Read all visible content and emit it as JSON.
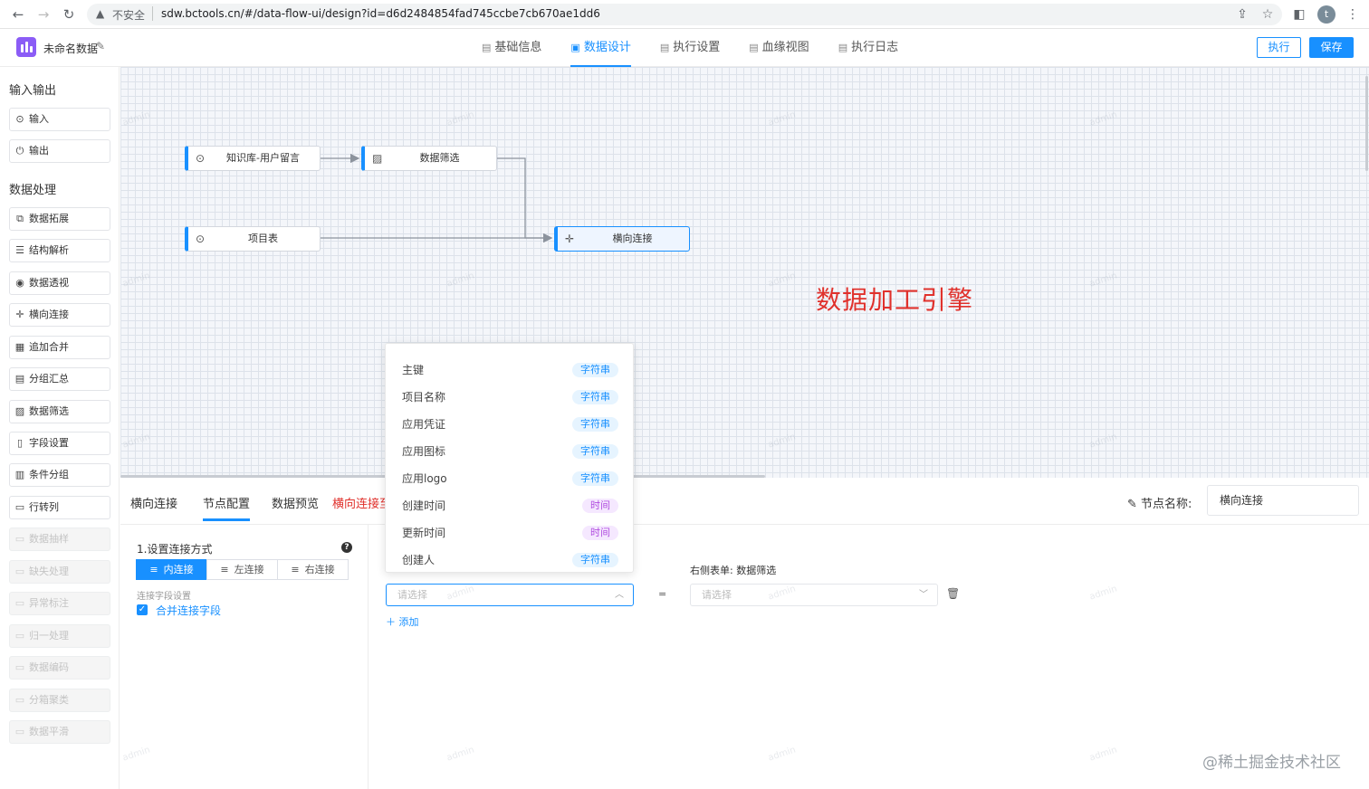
{
  "browser": {
    "insecure_label": "不安全",
    "url": "sdw.bctools.cn/#/data-flow-ui/design?id=d6d2484854fad745ccbe7cb670ae1dd6",
    "profile_initial": "t"
  },
  "header": {
    "app_title": "未命名数据",
    "tabs": [
      {
        "label": "基础信息",
        "icon": "document-icon"
      },
      {
        "label": "数据设计",
        "icon": "design-icon",
        "active": true
      },
      {
        "label": "执行设置",
        "icon": "document-icon"
      },
      {
        "label": "血缘视图",
        "icon": "document-icon"
      },
      {
        "label": "执行日志",
        "icon": "document-icon"
      }
    ],
    "run_label": "执行",
    "save_label": "保存"
  },
  "sidebar": {
    "io_title": "输入输出",
    "io_items": [
      {
        "label": "输入",
        "icon": "play-circle-icon"
      },
      {
        "label": "输出",
        "icon": "power-icon"
      }
    ],
    "proc_title": "数据处理",
    "proc_items": [
      {
        "label": "数据拓展",
        "icon": "copy-icon"
      },
      {
        "label": "结构解析",
        "icon": "sliders-icon"
      },
      {
        "label": "数据透视",
        "icon": "eye-icon"
      },
      {
        "label": "横向连接",
        "icon": "move-icon"
      },
      {
        "label": "追加合并",
        "icon": "calendar-icon"
      },
      {
        "label": "分组汇总",
        "icon": "list-icon"
      },
      {
        "label": "数据筛选",
        "icon": "filter-doc-icon"
      },
      {
        "label": "字段设置",
        "icon": "doc-icon"
      },
      {
        "label": "条件分组",
        "icon": "grid-icon"
      },
      {
        "label": "行转列",
        "icon": "folder-icon"
      },
      {
        "label": "数据抽样",
        "icon": "folder-icon",
        "disabled": true
      },
      {
        "label": "缺失处理",
        "icon": "folder-icon",
        "disabled": true
      },
      {
        "label": "异常标注",
        "icon": "folder-icon",
        "disabled": true
      },
      {
        "label": "归一处理",
        "icon": "folder-icon",
        "disabled": true
      },
      {
        "label": "数据编码",
        "icon": "folder-icon",
        "disabled": true
      },
      {
        "label": "分箱聚类",
        "icon": "folder-icon",
        "disabled": true
      },
      {
        "label": "数据平滑",
        "icon": "folder-icon",
        "disabled": true
      }
    ]
  },
  "canvas": {
    "nodes": [
      {
        "label": "知识库-用户留言",
        "icon": "play-circle-icon"
      },
      {
        "label": "数据筛选",
        "icon": "filter-doc-icon"
      },
      {
        "label": "项目表",
        "icon": "play-circle-icon"
      },
      {
        "label": "横向连接",
        "icon": "move-icon",
        "selected": true
      }
    ],
    "annotation": "数据加工引擎"
  },
  "bottom": {
    "tabs": [
      "横向连接",
      "节点配置",
      "数据预览",
      "横向连接至"
    ],
    "active_tab": "节点配置",
    "node_name_label": "节点名称:",
    "node_name_value": "横向连接",
    "join_title": "1.设置连接方式",
    "join_types": [
      "内连接",
      "左连接",
      "右连接"
    ],
    "active_join": "内连接",
    "join_field_label": "连接字段设置",
    "merge_label": "合并连接字段",
    "merge_checked": true,
    "right_table_label": "右侧表单: 数据筛选",
    "left_placeholder": "请选择",
    "equals": "=",
    "right_placeholder": "请选择",
    "add_label": "添加"
  },
  "dropdown": {
    "options": [
      {
        "name": "主键",
        "type": "字符串",
        "kind": "str"
      },
      {
        "name": "项目名称",
        "type": "字符串",
        "kind": "str"
      },
      {
        "name": "应用凭证",
        "type": "字符串",
        "kind": "str"
      },
      {
        "name": "应用图标",
        "type": "字符串",
        "kind": "str"
      },
      {
        "name": "应用logo",
        "type": "字符串",
        "kind": "str"
      },
      {
        "name": "创建时间",
        "type": "时间",
        "kind": "time"
      },
      {
        "name": "更新时间",
        "type": "时间",
        "kind": "time"
      },
      {
        "name": "创建人",
        "type": "字符串",
        "kind": "str"
      }
    ]
  },
  "watermark": "admin",
  "footer_mark": "@稀土掘金技术社区",
  "colors": {
    "accent": "#1890ff",
    "annotation_red": "#e0312c",
    "logo": "#8b5cf6"
  }
}
